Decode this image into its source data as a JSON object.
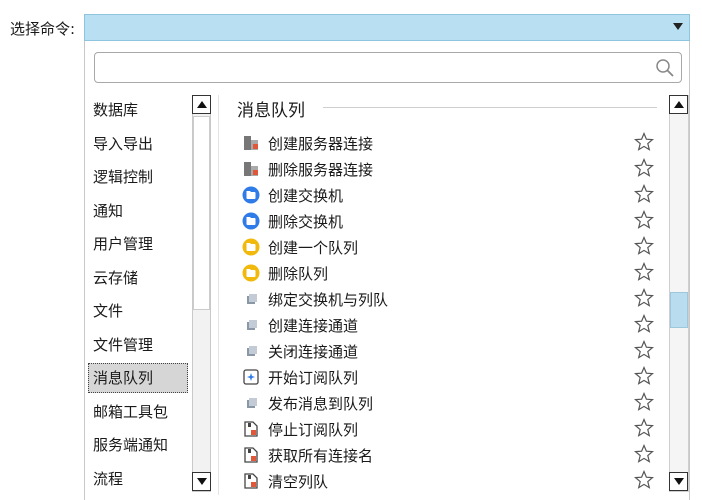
{
  "label": "选择命令:",
  "search": {
    "placeholder": ""
  },
  "categories": [
    {
      "label": "数据库"
    },
    {
      "label": "导入导出"
    },
    {
      "label": "逻辑控制"
    },
    {
      "label": "通知"
    },
    {
      "label": "用户管理"
    },
    {
      "label": "云存储"
    },
    {
      "label": "文件"
    },
    {
      "label": "文件管理"
    },
    {
      "label": "消息队列",
      "selected": true
    },
    {
      "label": "邮箱工具包"
    },
    {
      "label": "服务端通知"
    },
    {
      "label": "流程"
    }
  ],
  "section": {
    "title": "消息队列"
  },
  "commands": [
    {
      "label": "创建服务器连接",
      "icon": "server-icon"
    },
    {
      "label": "删除服务器连接",
      "icon": "server-icon"
    },
    {
      "label": "创建交换机",
      "icon": "exchange-blue-icon"
    },
    {
      "label": "删除交换机",
      "icon": "exchange-blue-icon"
    },
    {
      "label": "创建一个队列",
      "icon": "queue-yellow-icon"
    },
    {
      "label": "删除队列",
      "icon": "queue-yellow-icon"
    },
    {
      "label": "绑定交换机与列队",
      "icon": "cube-icon"
    },
    {
      "label": "创建连接通道",
      "icon": "cube-icon"
    },
    {
      "label": "关闭连接通道",
      "icon": "cube-icon"
    },
    {
      "label": "开始订阅队列",
      "icon": "subscribe-icon"
    },
    {
      "label": "发布消息到队列",
      "icon": "cube-icon"
    },
    {
      "label": "停止订阅队列",
      "icon": "stop-icon"
    },
    {
      "label": "获取所有连接名",
      "icon": "stop-icon"
    },
    {
      "label": "清空列队",
      "icon": "stop-icon"
    }
  ],
  "colors": {
    "combo_bg": "#b8dff2",
    "scroll_thumb": "#b9dcee",
    "selected_bg": "#d6d6d6"
  }
}
